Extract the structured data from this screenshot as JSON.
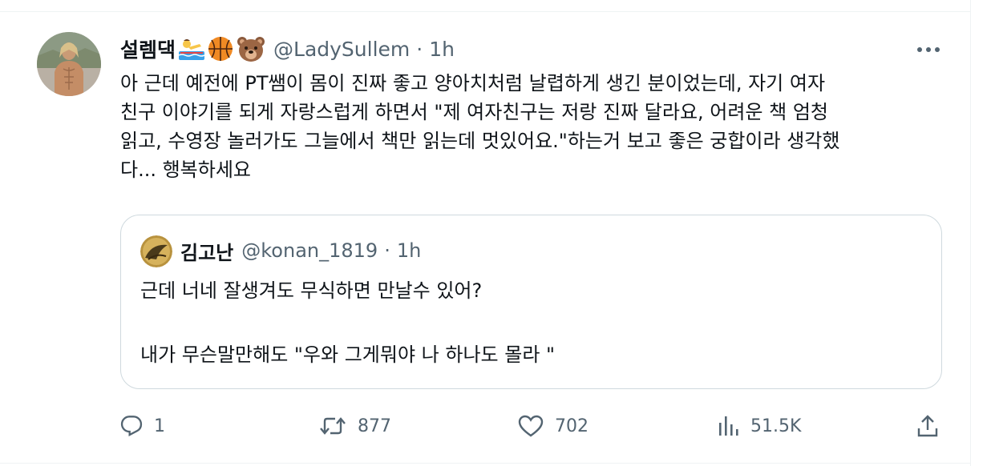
{
  "tweet": {
    "display_name": "설렘댁",
    "handle": "@LadySullem",
    "separator": "·",
    "time": "1h",
    "text": "아 근데 예전에 PT쌤이 몸이 진짜 좋고 양아치처럼 날렵하게 생긴 분이었는데, 자기 여자\n친구 이야기를 되게 자랑스럽게 하면서 \"제 여자친구는 저랑 진짜 달라요, 어려운 책 엄청\n읽고, 수영장 놀러가도 그늘에서 책만 읽는데 멋있어요.\"하는거 보고 좋은 궁합이라 생각했\n다... 행복하세요",
    "name_emojis": [
      "person-swimming-emoji",
      "basketball-emoji",
      "bear-face-emoji"
    ]
  },
  "quoted_tweet": {
    "display_name": "김고난",
    "handle": "@konan_1819",
    "separator": "·",
    "time": "1h",
    "line1": "근데 너네 잘생겨도 무식하면 만날수 있어?",
    "line2": "내가 무슨말만해도 \"우와 그게뭐야 나 하나도 몰라 \""
  },
  "actions": {
    "replies": "1",
    "reposts": "877",
    "likes": "702",
    "views": "51.5K"
  },
  "icons": {
    "more": "more-dots-icon",
    "reply": "reply-icon",
    "repost": "repost-icon",
    "like": "heart-icon",
    "views": "views-chart-icon",
    "share": "share-icon"
  },
  "colors": {
    "text_primary": "#0f1419",
    "text_secondary": "#536471",
    "border": "#cfd9de"
  }
}
